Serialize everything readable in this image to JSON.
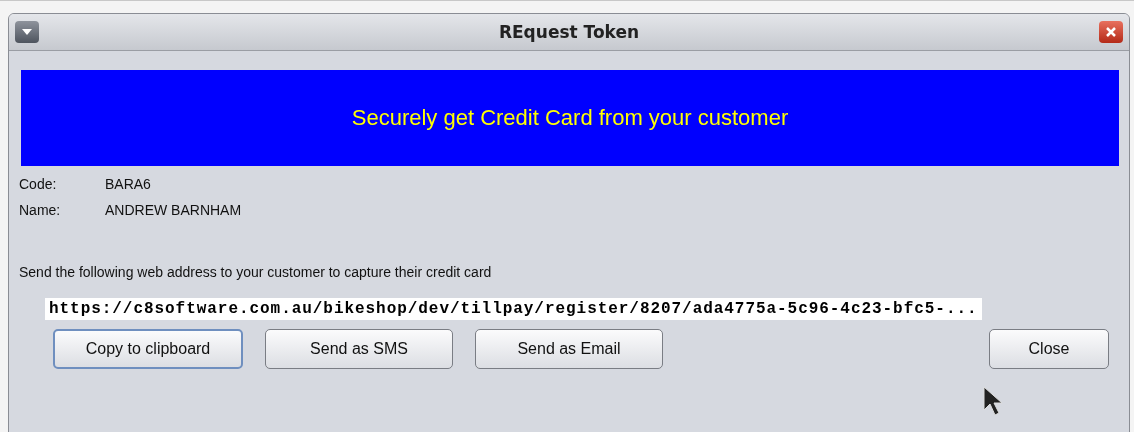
{
  "window": {
    "title": "REquest Token"
  },
  "banner": "Securely get Credit Card from your customer",
  "fields": [
    {
      "label": "Code:",
      "value": "BARA6"
    },
    {
      "label": "Name:",
      "value": "ANDREW BARNHAM"
    }
  ],
  "instruction": "Send the following web address to your customer to capture their credit card",
  "url": "https://c8software.com.au/bikeshop/dev/tillpay/register/8207/ada4775a-5c96-4c23-bfc5-...",
  "buttons": [
    {
      "label": "Copy to clipboard",
      "focused": true
    },
    {
      "label": "Send as SMS",
      "focused": false
    },
    {
      "label": "Send as Email",
      "focused": false
    }
  ],
  "close_button": {
    "label": "Close"
  }
}
